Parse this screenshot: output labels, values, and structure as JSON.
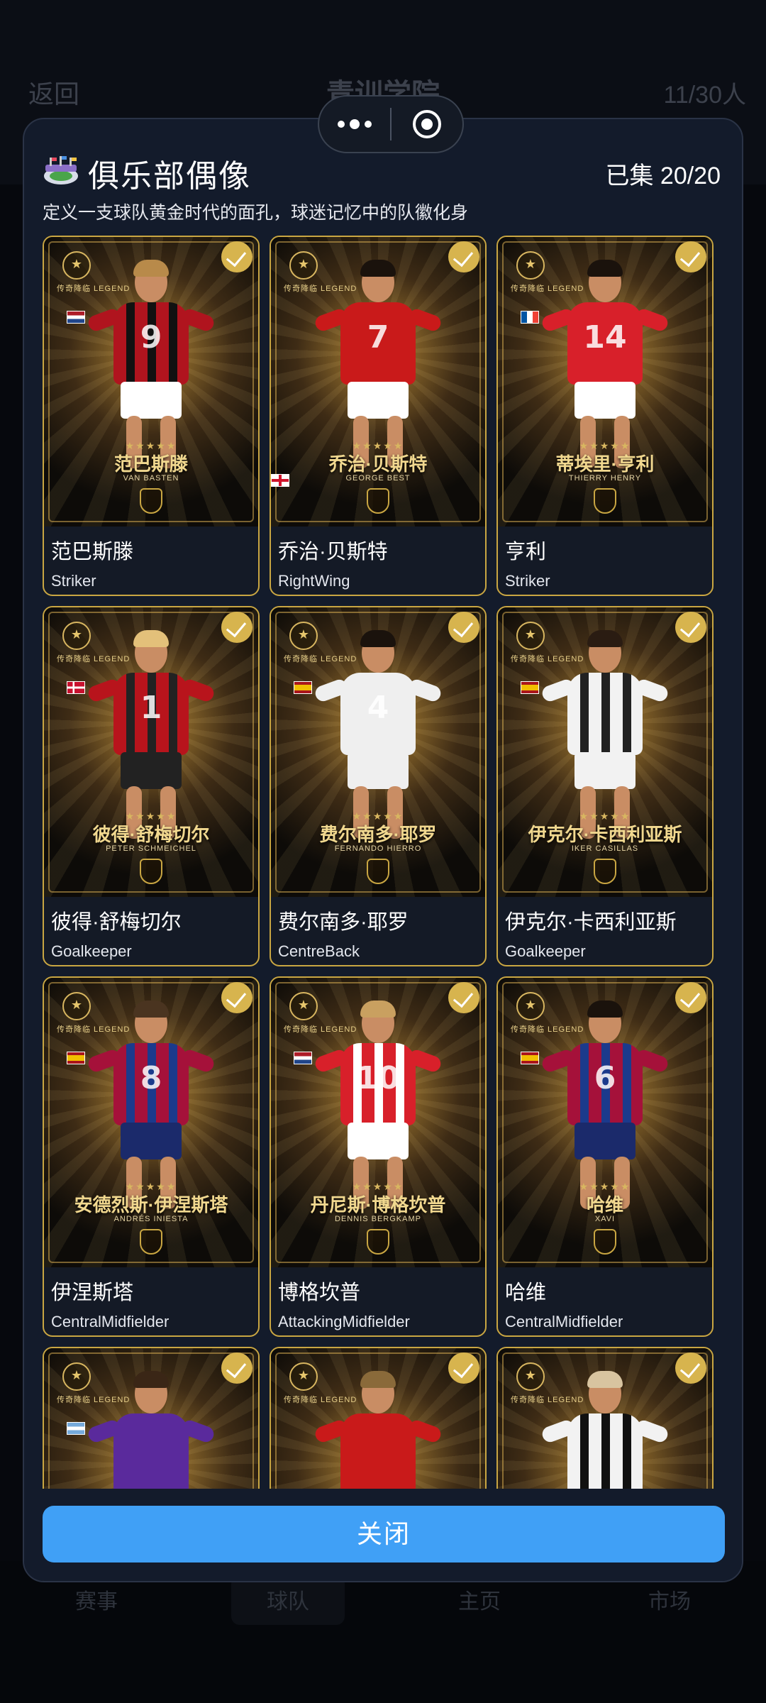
{
  "background": {
    "back_label": "返回",
    "page_title": "青训学院",
    "player_count": "11/30人",
    "nav": [
      "赛事",
      "球队",
      "主页",
      "市场"
    ]
  },
  "modal": {
    "title": "俱乐部偶像",
    "collected": "已集 20/20",
    "subtitle": "定义一支球队黄金时代的面孔，球迷记忆中的队徽化身",
    "close_label": "关闭"
  },
  "legend_tag": "传奇降临 LEGEND",
  "stars": "★★★★★",
  "cards": [
    {
      "name": "范巴斯滕",
      "position": "Striker",
      "card_cn": "范巴斯滕",
      "card_en": "VAN BASTEN",
      "flag": "nl",
      "jersey": "#b0141e",
      "stripe": "#111111",
      "shorts": "#ffffff",
      "hair": "#b88a4a",
      "number": "9",
      "checked": true
    },
    {
      "name": "乔治·贝斯特",
      "position": "RightWing",
      "card_cn": "乔治·贝斯特",
      "card_en": "GEORGE BEST",
      "flag": "en",
      "jersey": "#c91a1a",
      "stripe": "#c91a1a",
      "shorts": "#ffffff",
      "hair": "#1a120c",
      "number": "7",
      "checked": true
    },
    {
      "name": "亨利",
      "position": "Striker",
      "card_cn": "蒂埃里·亨利",
      "card_en": "THIERRY HENRY",
      "flag": "fr",
      "jersey": "#d8202a",
      "stripe": "#d8202a",
      "shorts": "#ffffff",
      "hair": "#1a120c",
      "number": "14",
      "checked": true
    },
    {
      "name": "彼得·舒梅切尔",
      "position": "Goalkeeper",
      "card_cn": "彼得·舒梅切尔",
      "card_en": "PETER SCHMEICHEL",
      "flag": "dk",
      "jersey": "#b8141c",
      "stripe": "#222222",
      "shorts": "#222222",
      "hair": "#e3c07a",
      "number": "1",
      "checked": true
    },
    {
      "name": "费尔南多·耶罗",
      "position": "CentreBack",
      "card_cn": "费尔南多·耶罗",
      "card_en": "FERNANDO HIERRO",
      "flag": "es",
      "jersey": "#efefef",
      "stripe": "#efefef",
      "shorts": "#efefef",
      "hair": "#1a120c",
      "number": "4",
      "checked": true
    },
    {
      "name": "伊克尔·卡西利亚斯",
      "position": "Goalkeeper",
      "card_cn": "伊克尔·卡西利亚斯",
      "card_en": "IKER CASILLAS",
      "flag": "es",
      "jersey": "#f2f2f2",
      "stripe": "#222222",
      "shorts": "#f2f2f2",
      "hair": "#2a1c12",
      "number": "",
      "checked": true
    },
    {
      "name": "伊涅斯塔",
      "position": "CentralMidfielder",
      "card_cn": "安德烈斯·伊涅斯塔",
      "card_en": "ANDRÉS INIESTA",
      "flag": "es",
      "jersey": "#a5113a",
      "stripe": "#1b3a8c",
      "shorts": "#1b2a6b",
      "hair": "#4a3420",
      "number": "8",
      "checked": true
    },
    {
      "name": "博格坎普",
      "position": "AttackingMidfielder",
      "card_cn": "丹尼斯·博格坎普",
      "card_en": "DENNIS BERGKAMP",
      "flag": "nl",
      "jersey": "#d8202a",
      "stripe": "#ffffff",
      "shorts": "#ffffff",
      "hair": "#c9a060",
      "number": "10",
      "checked": true
    },
    {
      "name": "哈维",
      "position": "CentralMidfielder",
      "card_cn": "哈维",
      "card_en": "XAVI",
      "flag": "es",
      "jersey": "#a5113a",
      "stripe": "#1b3a8c",
      "shorts": "#1b2a6b",
      "hair": "#1a120c",
      "number": "6",
      "checked": true
    },
    {
      "name": "",
      "position": "",
      "card_cn": "",
      "card_en": "",
      "flag": "ar",
      "jersey": "#5a2a9c",
      "stripe": "#5a2a9c",
      "shorts": "#5a2a9c",
      "hair": "#3a2616",
      "number": "",
      "checked": true
    },
    {
      "name": "",
      "position": "",
      "card_cn": "",
      "card_en": "",
      "flag": "en",
      "jersey": "#c91a1a",
      "stripe": "#c91a1a",
      "shorts": "#ffffff",
      "hair": "#8a6a3a",
      "number": "",
      "checked": true
    },
    {
      "name": "",
      "position": "",
      "card_cn": "",
      "card_en": "",
      "flag": "en",
      "jersey": "#f2f2f2",
      "stripe": "#111111",
      "shorts": "#111111",
      "hair": "#d8c4a0",
      "number": "",
      "checked": true
    }
  ],
  "colors": {
    "modal_bg": "#131b2b",
    "card_border": "#c9a642",
    "check": "#d7b44e",
    "close_button": "#40a0f6"
  }
}
